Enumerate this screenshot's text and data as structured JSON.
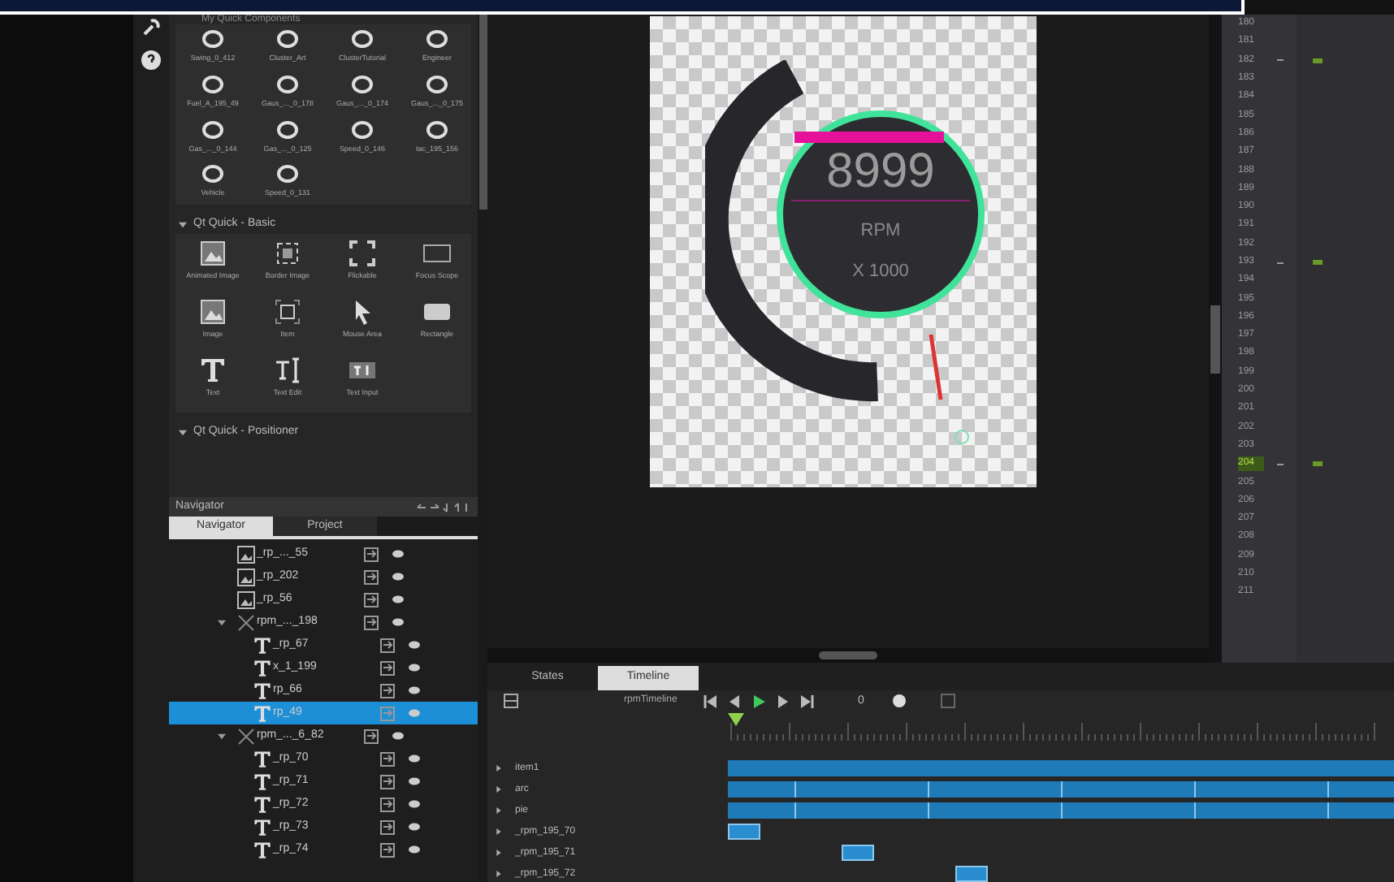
{
  "library": {
    "section_header": "My Quick Components",
    "components": [
      "Swing_0_412",
      "Cluster_Art",
      "ClusterTutorial",
      "Engineer",
      "Fuel_A_195_49",
      "Gaus_..._0_178",
      "Gaus_..._0_174",
      "Gaus_..._0_175",
      "Gas_..._0_144",
      "Gas_..._0_125",
      "Speed_0_146",
      "tac_195_156",
      "Vehicle",
      "Speed_0_131"
    ],
    "basic_title": "Qt Quick - Basic",
    "basic": [
      {
        "label": "Animated Image",
        "kind": "animated-image"
      },
      {
        "label": "Border Image",
        "kind": "border-image"
      },
      {
        "label": "Flickable",
        "kind": "flickable"
      },
      {
        "label": "Focus Scope",
        "kind": "focus-scope"
      },
      {
        "label": "Image",
        "kind": "image"
      },
      {
        "label": "Item",
        "kind": "item"
      },
      {
        "label": "Mouse Area",
        "kind": "mouse-area"
      },
      {
        "label": "Rectangle",
        "kind": "rectangle"
      },
      {
        "label": "Text",
        "kind": "text"
      },
      {
        "label": "Text Edit",
        "kind": "text-edit"
      },
      {
        "label": "Text Input",
        "kind": "text-input"
      }
    ],
    "positioner_title": "Qt Quick - Positioner"
  },
  "navigator": {
    "title": "Navigator",
    "tabs": [
      {
        "label": "Navigator",
        "selected": true
      },
      {
        "label": "Project",
        "selected": false
      }
    ],
    "tree": [
      {
        "name": "_rp_..._55",
        "kind": "image",
        "selected": false
      },
      {
        "name": "_rp_202",
        "kind": "image",
        "selected": false
      },
      {
        "name": "_rp_56",
        "kind": "image",
        "selected": false
      },
      {
        "name": "rpm_..._198",
        "kind": "group",
        "expanded": true,
        "selected": false,
        "children": [
          {
            "name": "_rp_67",
            "kind": "text",
            "selected": false
          },
          {
            "name": "x_1_199",
            "kind": "text",
            "selected": false
          },
          {
            "name": "rp_66",
            "kind": "text",
            "selected": false
          },
          {
            "name": "rp_49",
            "kind": "text",
            "selected": true
          }
        ]
      },
      {
        "name": "rpm_..._6_82",
        "kind": "group",
        "expanded": true,
        "selected": false,
        "children": [
          {
            "name": "_rp_70",
            "kind": "text",
            "selected": false
          },
          {
            "name": "_rp_71",
            "kind": "text",
            "selected": false
          },
          {
            "name": "_rp_72",
            "kind": "text",
            "selected": false
          },
          {
            "name": "_rp_73",
            "kind": "text",
            "selected": false
          },
          {
            "name": "_rp_74",
            "kind": "text",
            "selected": false
          }
        ]
      }
    ]
  },
  "canvas": {
    "reading": "8999",
    "unit": "RPM",
    "multiplier": "X 1000"
  },
  "editor": {
    "lines": [
      {
        "n": "180",
        "fold": false,
        "current": false
      },
      {
        "n": "181",
        "fold": false,
        "current": false
      },
      {
        "n": "182",
        "fold": true,
        "current": false
      },
      {
        "n": "183",
        "fold": false,
        "current": false
      },
      {
        "n": "184",
        "fold": false,
        "current": false
      },
      {
        "n": "185",
        "fold": false,
        "current": false
      },
      {
        "n": "186",
        "fold": false,
        "current": false
      },
      {
        "n": "187",
        "fold": false,
        "current": false
      },
      {
        "n": "188",
        "fold": false,
        "current": false
      },
      {
        "n": "189",
        "fold": false,
        "current": false
      },
      {
        "n": "190",
        "fold": false,
        "current": false
      },
      {
        "n": "191",
        "fold": false,
        "current": false
      },
      {
        "n": "192",
        "fold": false,
        "current": false
      },
      {
        "n": "193",
        "fold": true,
        "current": false
      },
      {
        "n": "194",
        "fold": false,
        "current": false
      },
      {
        "n": "195",
        "fold": false,
        "current": false
      },
      {
        "n": "196",
        "fold": false,
        "current": false
      },
      {
        "n": "197",
        "fold": false,
        "current": false
      },
      {
        "n": "198",
        "fold": false,
        "current": false
      },
      {
        "n": "199",
        "fold": false,
        "current": false
      },
      {
        "n": "200",
        "fold": false,
        "current": false
      },
      {
        "n": "201",
        "fold": false,
        "current": false
      },
      {
        "n": "202",
        "fold": false,
        "current": false
      },
      {
        "n": "203",
        "fold": false,
        "current": false
      },
      {
        "n": "204",
        "fold": true,
        "current": true
      },
      {
        "n": "205",
        "fold": false,
        "current": false
      },
      {
        "n": "206",
        "fold": false,
        "current": false
      },
      {
        "n": "207",
        "fold": false,
        "current": false
      },
      {
        "n": "208",
        "fold": false,
        "current": false
      },
      {
        "n": "209",
        "fold": false,
        "current": false
      },
      {
        "n": "210",
        "fold": false,
        "current": false
      },
      {
        "n": "211",
        "fold": false,
        "current": false
      }
    ]
  },
  "timeline": {
    "tabs": [
      {
        "label": "States",
        "selected": false
      },
      {
        "label": "Timeline",
        "selected": true
      }
    ],
    "name": "rpmTimeline",
    "frame": "0",
    "tracks": [
      {
        "name": "item1",
        "kind": "full"
      },
      {
        "name": "arc",
        "kind": "keyframed"
      },
      {
        "name": "pie",
        "kind": "keyframed"
      },
      {
        "name": "_rpm_195_70",
        "kind": "segment"
      },
      {
        "name": "_rpm_195_71",
        "kind": "segment"
      },
      {
        "name": "_rpm_195_72",
        "kind": "segment"
      }
    ]
  }
}
